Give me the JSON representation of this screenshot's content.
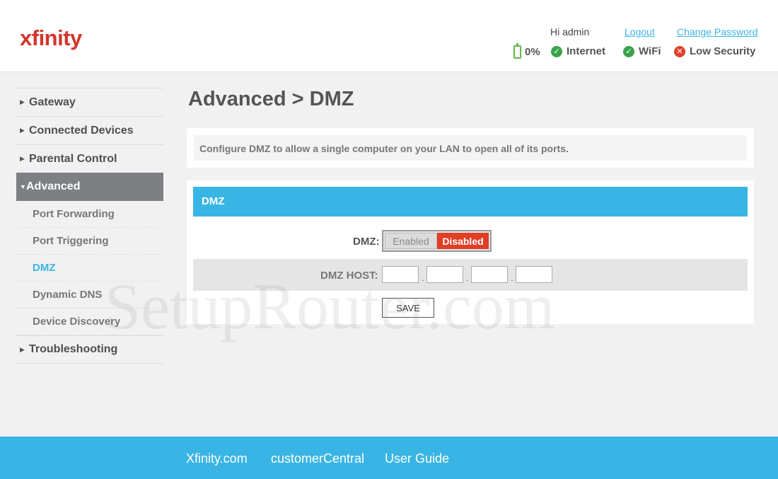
{
  "header": {
    "logo": "xfinity",
    "greeting": "Hi admin",
    "logout": "Logout",
    "change_password": "Change Password",
    "status": {
      "battery": "0%",
      "internet": "Internet",
      "wifi": "WiFi",
      "security": "Low Security"
    }
  },
  "sidebar": {
    "items": [
      {
        "label": "Gateway"
      },
      {
        "label": "Connected Devices"
      },
      {
        "label": "Parental Control"
      },
      {
        "label": "Advanced"
      },
      {
        "label": "Troubleshooting"
      }
    ],
    "advanced_sub": [
      {
        "label": "Port Forwarding"
      },
      {
        "label": "Port Triggering"
      },
      {
        "label": "DMZ"
      },
      {
        "label": "Dynamic DNS"
      },
      {
        "label": "Device Discovery"
      }
    ]
  },
  "main": {
    "title": "Advanced > DMZ",
    "info": "Configure DMZ to allow a single computer on your LAN to open all of its ports.",
    "panel_title": "DMZ",
    "dmz_label": "DMZ:",
    "toggle": {
      "enabled": "Enabled",
      "disabled": "Disabled",
      "selected": "Disabled"
    },
    "host_label": "DMZ HOST:",
    "host_octets": [
      "",
      "",
      "",
      ""
    ],
    "save": "SAVE"
  },
  "footer": {
    "links": [
      "Xfinity.com",
      "customerCentral",
      "User Guide"
    ]
  },
  "watermark": "SetupRouter.com",
  "colors": {
    "brand_red": "#d4342b",
    "accent_blue": "#39b5e5",
    "ok_green": "#3aa34a",
    "alert_red": "#e0402e"
  }
}
